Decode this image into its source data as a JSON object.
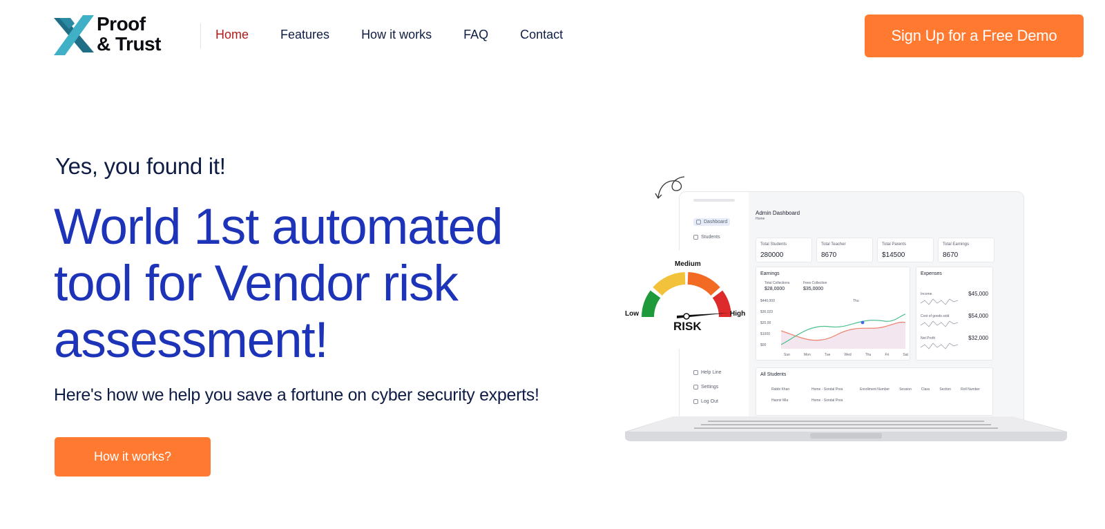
{
  "brand": {
    "line1": "Proof",
    "line2": "& Trust",
    "colors": {
      "mark_dark": "#1f6e86",
      "mark_light": "#3fb0c6",
      "text": "#0b0d12"
    }
  },
  "nav": {
    "items": [
      {
        "label": "Home",
        "active": true
      },
      {
        "label": "Features",
        "active": false
      },
      {
        "label": "How it works",
        "active": false
      },
      {
        "label": "FAQ",
        "active": false
      },
      {
        "label": "Contact",
        "active": false
      }
    ],
    "cta_label": "Sign Up for a Free Demo"
  },
  "hero": {
    "kicker": "Yes, you found it!",
    "headline": "World 1st automated tool for Vendor risk assessment!",
    "subhead": "Here's how we help you save a fortune on cyber security experts!",
    "cta_label": "How it works?"
  },
  "illustration": {
    "dashboard_title": "Admin Dashboard",
    "breadcrumb": "Home",
    "sidebar": [
      "Dashboard",
      "Students",
      "Help Line",
      "Settings",
      "Log Out"
    ],
    "stats": [
      {
        "label": "Total Students",
        "value": "280000"
      },
      {
        "label": "Total Teacher",
        "value": "8670"
      },
      {
        "label": "Total Parents",
        "value": "$14500"
      },
      {
        "label": "Total Earnings",
        "value": "8670"
      }
    ],
    "earnings": {
      "title": "Earnings",
      "legend": [
        {
          "label": "Total Collections",
          "value": "$28,0000"
        },
        {
          "label": "Fees Collection",
          "value": "$35,0000"
        }
      ],
      "y_ticks": [
        "$440,000",
        "$30,023",
        "$20,00",
        "$1000",
        "$00"
      ],
      "x_ticks": [
        "Sun",
        "Mon",
        "Tue",
        "Wed",
        "Thu",
        "Fri",
        "Sat"
      ],
      "tooltip": "Thu"
    },
    "expenses": {
      "title": "Expenses",
      "rows": [
        {
          "label": "Income",
          "value": "$45,000"
        },
        {
          "label": "Cost of goods sold",
          "value": "$54,000"
        },
        {
          "label": "Net Profit",
          "value": "$32,000"
        }
      ]
    },
    "students": {
      "title": "All Students",
      "headers": [
        "Enrollment Number",
        "Session",
        "Class",
        "Section",
        "Roll Number"
      ],
      "rows": [
        {
          "name": "Rabbi Khan",
          "place": "Home - Sondal Pora"
        },
        {
          "name": "Haonir Mia",
          "place": "Home - Sondal Pora"
        }
      ]
    },
    "risk": {
      "label": "RISK",
      "low": "Low",
      "medium": "Medium",
      "high": "High",
      "colors": {
        "green": "#1f9a3a",
        "yellow": "#f2c23a",
        "orange": "#f26a24",
        "red": "#dd2a2a"
      }
    }
  },
  "colors": {
    "accent": "#ff7a30",
    "headline": "#1d33b8",
    "nav_active": "#b21b1b",
    "text": "#0f1d45"
  }
}
